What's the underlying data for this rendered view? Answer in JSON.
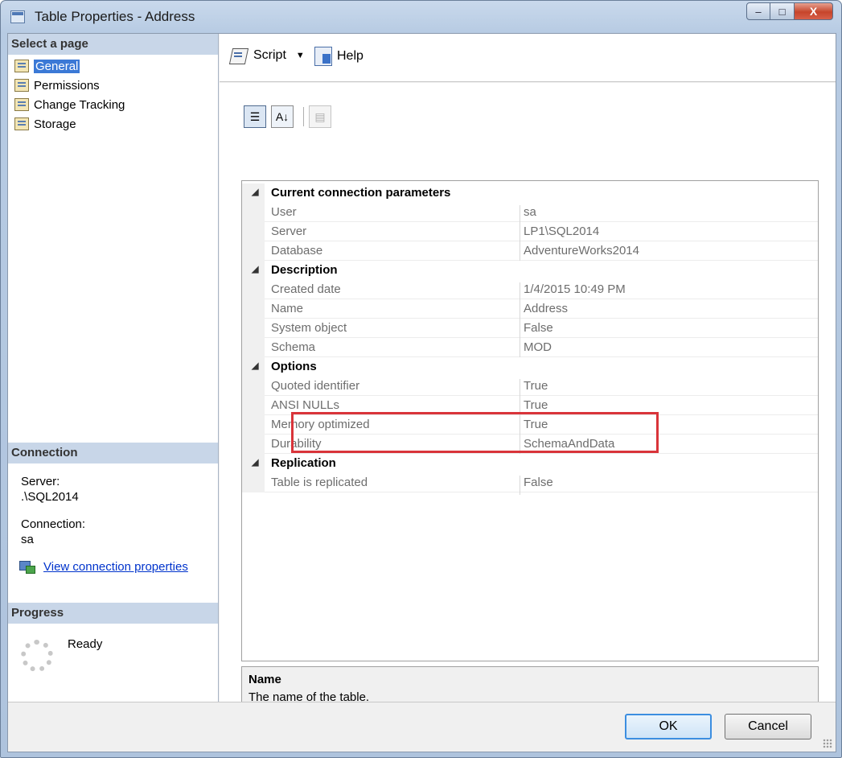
{
  "window": {
    "title": "Table Properties - Address",
    "minimize_glyph": "–",
    "maximize_glyph": "□",
    "close_glyph": "X"
  },
  "left": {
    "select_header": "Select a page",
    "pages": [
      {
        "label": "General",
        "icon": "page-icon"
      },
      {
        "label": "Permissions",
        "icon": "page-icon"
      },
      {
        "label": "Change Tracking",
        "icon": "page-icon"
      },
      {
        "label": "Storage",
        "icon": "page-icon"
      }
    ],
    "connection_header": "Connection",
    "server_label": "Server:",
    "server_value": ".\\SQL2014",
    "connection_label": "Connection:",
    "connection_value": "sa",
    "view_props_link": "View connection properties",
    "progress_header": "Progress",
    "progress_status": "Ready"
  },
  "toolbar": {
    "script_label": "Script",
    "help_label": "Help"
  },
  "grid_toolbar": {
    "categorized_glyph": "☰",
    "alpha_glyph": "A↓",
    "props_glyph": "▤"
  },
  "grid": {
    "collapse_glyph": "◢",
    "categories": [
      {
        "name": "Current connection parameters",
        "props": [
          {
            "name": "User",
            "value": "sa"
          },
          {
            "name": "Server",
            "value": "LP1\\SQL2014"
          },
          {
            "name": "Database",
            "value": "AdventureWorks2014"
          }
        ]
      },
      {
        "name": "Description",
        "props": [
          {
            "name": "Created date",
            "value": "1/4/2015 10:49 PM"
          },
          {
            "name": "Name",
            "value": "Address"
          },
          {
            "name": "System object",
            "value": "False"
          },
          {
            "name": "Schema",
            "value": "MOD"
          }
        ]
      },
      {
        "name": "Options",
        "props": [
          {
            "name": "Quoted identifier",
            "value": "True"
          },
          {
            "name": "ANSI NULLs",
            "value": "True"
          },
          {
            "name": "Memory optimized",
            "value": "True"
          },
          {
            "name": "Durability",
            "value": "SchemaAndData"
          }
        ]
      },
      {
        "name": "Replication",
        "props": [
          {
            "name": "Table is replicated",
            "value": "False"
          }
        ]
      }
    ]
  },
  "description": {
    "title": "Name",
    "text": "The name of the table."
  },
  "buttons": {
    "ok": "OK",
    "cancel": "Cancel"
  },
  "colors": {
    "selection": "#3b79d6",
    "header_bg": "#c8d6e8",
    "highlight_border": "#d9343a",
    "link": "#0033cc"
  }
}
